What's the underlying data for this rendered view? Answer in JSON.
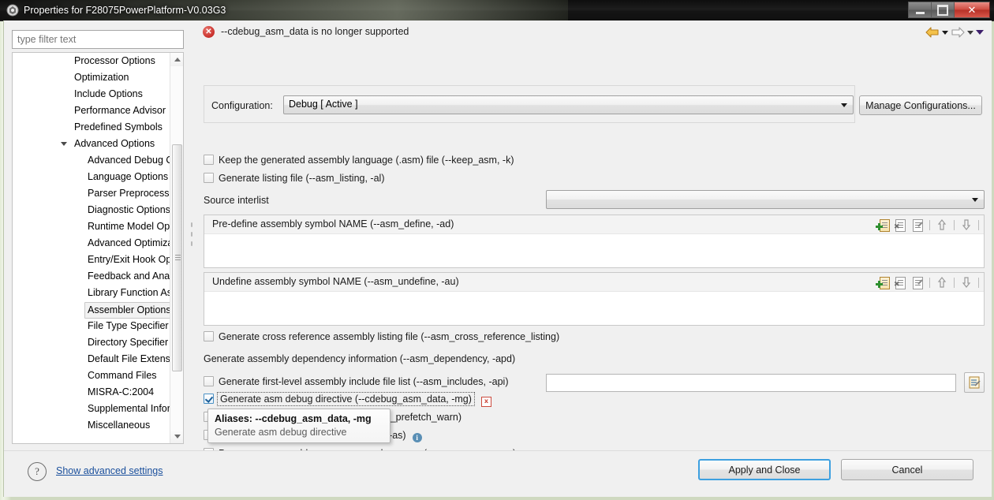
{
  "window": {
    "title": "Properties for F28075PowerPlatform-V0.03G3",
    "icon": "app-icon",
    "controls": {
      "minimize": "–",
      "maximize": "□",
      "close": "✕"
    }
  },
  "sidebar": {
    "filter": {
      "placeholder": "type filter text",
      "value": ""
    },
    "items": [
      {
        "label": "Processor Options",
        "indent": 78,
        "expandable": false,
        "selected": false
      },
      {
        "label": "Optimization",
        "indent": 78,
        "expandable": false,
        "selected": false
      },
      {
        "label": "Include Options",
        "indent": 78,
        "expandable": false,
        "selected": false
      },
      {
        "label": "Performance Advisor",
        "indent": 78,
        "expandable": false,
        "selected": false
      },
      {
        "label": "Predefined Symbols",
        "indent": 78,
        "expandable": false,
        "selected": false
      },
      {
        "label": "Advanced Options",
        "indent": 78,
        "expandable": true,
        "expanded": true,
        "selected": false
      },
      {
        "label": "Advanced Debug Options",
        "indent": 95,
        "expandable": false,
        "selected": false
      },
      {
        "label": "Language Options",
        "indent": 95,
        "expandable": false,
        "selected": false
      },
      {
        "label": "Parser Preprocessing",
        "indent": 95,
        "expandable": false,
        "selected": false
      },
      {
        "label": "Diagnostic Options",
        "indent": 95,
        "expandable": false,
        "selected": false
      },
      {
        "label": "Runtime Model Options",
        "indent": 95,
        "expandable": false,
        "selected": false
      },
      {
        "label": "Advanced Optimizations",
        "indent": 95,
        "expandable": false,
        "selected": false
      },
      {
        "label": "Entry/Exit Hook Options",
        "indent": 95,
        "expandable": false,
        "selected": false
      },
      {
        "label": "Feedback and Analysis",
        "indent": 95,
        "expandable": false,
        "selected": false
      },
      {
        "label": "Library Function Assumptions",
        "indent": 95,
        "expandable": false,
        "selected": false
      },
      {
        "label": "Assembler Options",
        "indent": 95,
        "expandable": false,
        "selected": true
      },
      {
        "label": "File Type Specifier",
        "indent": 95,
        "expandable": false,
        "selected": false
      },
      {
        "label": "Directory Specifier",
        "indent": 95,
        "expandable": false,
        "selected": false
      },
      {
        "label": "Default File Extensions",
        "indent": 95,
        "expandable": false,
        "selected": false
      },
      {
        "label": "Command Files",
        "indent": 95,
        "expandable": false,
        "selected": false
      },
      {
        "label": "MISRA-C:2004",
        "indent": 95,
        "expandable": false,
        "selected": false
      },
      {
        "label": "Supplemental Information",
        "indent": 95,
        "expandable": false,
        "selected": false
      },
      {
        "label": "Miscellaneous",
        "indent": 95,
        "expandable": false,
        "selected": false
      }
    ]
  },
  "message_bar": {
    "icon": "error-icon",
    "text": "--cdebug_asm_data is no longer supported",
    "nav": {
      "back_icon": "back-arrow-icon",
      "back_menu_icon": "chevron-down-icon",
      "forward_icon": "forward-arrow-icon",
      "forward_menu_icon": "chevron-down-icon",
      "view_menu_icon": "view-menu-chevron-icon"
    }
  },
  "configuration": {
    "label": "Configuration:",
    "value": "Debug  [ Active ]",
    "manage_button": "Manage Configurations..."
  },
  "options": {
    "keep_asm": "Keep the generated assembly language (.asm) file (--keep_asm, -k)",
    "asm_listing": "Generate listing file (--asm_listing, -al)",
    "source_interlist_label": "Source interlist",
    "source_interlist_value": "",
    "predefine_list_header": "Pre-define assembly symbol NAME (--asm_define, -ad)",
    "undefine_list_header": "Undefine assembly symbol NAME (--asm_undefine, -au)",
    "cross_reference": "Generate cross reference assembly listing file (--asm_cross_reference_listing)",
    "asm_dependency_label": "Generate assembly dependency information (--asm_dependency, -apd)",
    "asm_dependency_value": "",
    "asm_includes": "Generate first-level assembly include file list (--asm_includes, -api)",
    "cdebug_asm_data": "Generate asm debug directive (--cdebug_asm_data, -mg)",
    "flash_prefetch_warn": "Warn about flash prefetch issue (--flash_prefetch_warn)",
    "output_all_syms": "Output all symbols (--output_all_syms, -as)",
    "preproc_asm": "Preprocess assembly source, expand macros. (--preproc_asm, -mx)",
    "list_tool_icons": [
      "add-icon",
      "delete-icon",
      "edit-icon",
      "move-up-icon",
      "move-down-icon"
    ],
    "dependency_browse_icon": "browse-edit-icon",
    "error_badge": "x",
    "info_badge": "i"
  },
  "tooltip": {
    "title": "Aliases: --cdebug_asm_data, -mg",
    "body": "Generate asm debug directive"
  },
  "footer": {
    "help_icon": "help-icon",
    "advanced_link": "Show advanced settings",
    "apply_button": "Apply and Close",
    "cancel_button": "Cancel"
  },
  "colors": {
    "accent": "#3da0e0",
    "error": "#c9302c",
    "link": "#1a4f9c",
    "dialog_bg": "#f0f0f0"
  }
}
